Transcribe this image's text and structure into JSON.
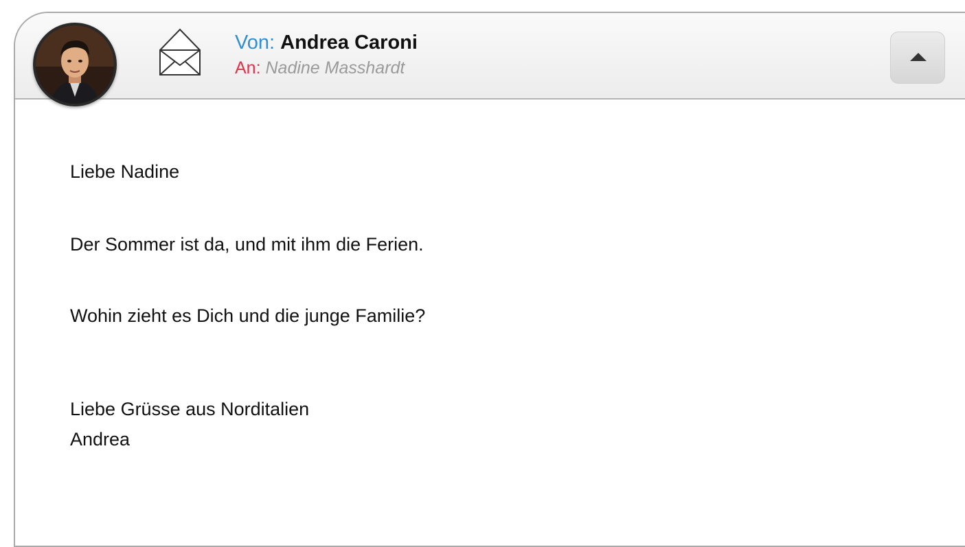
{
  "header": {
    "avatar_alt": "Andrea Caroni",
    "envelope_icon": "open-envelope-icon",
    "from_label": "Von:",
    "from_name": "Andrea Caroni",
    "to_label": "An:",
    "to_name": "Nadine Masshardt",
    "collapse_icon": "triangle-up-icon"
  },
  "message": {
    "greeting": "Liebe Nadine",
    "line1": "Der Sommer ist da, und mit ihm die Ferien.",
    "line2": "Wohin zieht es Dich und die junge Familie?",
    "closing": "Liebe Grüsse aus Norditalien",
    "signature": "Andrea"
  },
  "colors": {
    "from_label": "#2f8fd0",
    "to_label": "#e0324b",
    "to_name": "#9a9a9a",
    "border": "#a9a9a9"
  }
}
